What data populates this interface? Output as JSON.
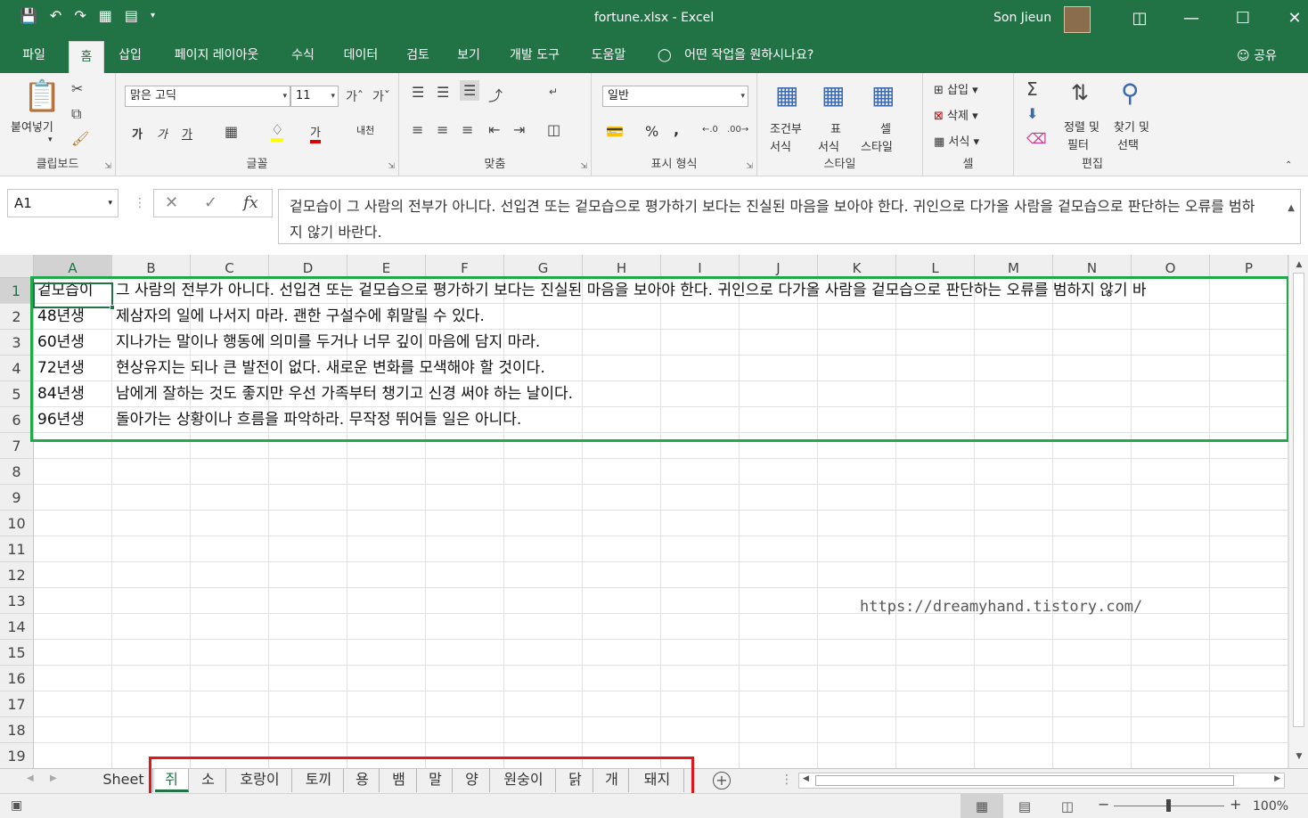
{
  "window": {
    "title": "fortune.xlsx  -  Excel",
    "user": "Son Jieun"
  },
  "menu": {
    "tabs": [
      "파일",
      "홈",
      "삽입",
      "페이지 레이아웃",
      "수식",
      "데이터",
      "검토",
      "보기",
      "개발 도구",
      "도움말"
    ],
    "active_tab": "홈",
    "tell_me": "어떤 작업을 원하시나요?",
    "share": "공유"
  },
  "ribbon": {
    "clipboard": {
      "label": "클립보드",
      "paste": "붙여넣기"
    },
    "font": {
      "label": "글꼴",
      "name": "맑은 고딕",
      "size": "11",
      "bold": "가",
      "italic": "가",
      "underline": "가",
      "color_glyph": "가",
      "phonetic": "내천"
    },
    "alignment": {
      "label": "맞춤"
    },
    "number": {
      "label": "표시 형식",
      "format": "일반",
      "percent": "%",
      "comma": ","
    },
    "styles": {
      "label": "스타일",
      "conditional": "조건부",
      "conditional2": "서식",
      "table": "표",
      "table2": "서식",
      "cell": "셀",
      "cell2": "스타일"
    },
    "cells": {
      "label": "셀",
      "insert": "삽입",
      "delete": "삭제",
      "format": "서식"
    },
    "editing": {
      "label": "편집",
      "sort": "정렬 및",
      "sort2": "필터",
      "find": "찾기 및",
      "find2": "선택"
    }
  },
  "formula_bar": {
    "name_box": "A1",
    "formula": "겉모습이 그 사람의 전부가 아니다. 선입견 또는 겉모습으로 평가하기 보다는 진실된 마음을 보아야 한다. 귀인으로 다가올 사람을 겉모습으로 판단하는 오류를 범하지 않기 바란다."
  },
  "grid": {
    "columns": [
      "A",
      "B",
      "C",
      "D",
      "E",
      "F",
      "G",
      "H",
      "I",
      "J",
      "K",
      "L",
      "M",
      "N",
      "O",
      "P"
    ],
    "rows": [
      "1",
      "2",
      "3",
      "4",
      "5",
      "6",
      "7",
      "8",
      "9",
      "10",
      "11",
      "12",
      "13",
      "14",
      "15",
      "16",
      "17",
      "18",
      "19"
    ],
    "cells": [
      {
        "a": "겉모습이",
        "b": "그 사람의 전부가 아니다. 선입견 또는 겉모습으로 평가하기 보다는 진실된 마음을 보아야 한다. 귀인으로 다가올 사람을 겉모습으로 판단하는 오류를 범하지 않기 바"
      },
      {
        "a": "48년생",
        "b": "제삼자의 일에 나서지 마라. 괜한 구설수에 휘말릴 수 있다."
      },
      {
        "a": "60년생",
        "b": "지나가는 말이나 행동에 의미를 두거나 너무 깊이 마음에 담지 마라."
      },
      {
        "a": "72년생",
        "b": "현상유지는 되나 큰 발전이 없다. 새로운 변화를 모색해야 할 것이다."
      },
      {
        "a": "84년생",
        "b": "남에게 잘하는 것도 좋지만 우선 가족부터 챙기고 신경 써야 하는 날이다."
      },
      {
        "a": "96년생",
        "b": "돌아가는 상황이나 흐름을 파악하라. 무작정 뛰어들 일은 아니다."
      }
    ],
    "watermark": "https://dreamyhand.tistory.com/"
  },
  "sheets": {
    "tabs": [
      "Sheet",
      "쥐",
      "소",
      "호랑이",
      "토끼",
      "용",
      "뱀",
      "말",
      "양",
      "원숭이",
      "닭",
      "개",
      "돼지"
    ],
    "active": "쥐"
  },
  "status": {
    "zoom": "100%"
  },
  "colors": {
    "accent": "#217346",
    "green_highlight": "#21a84b",
    "red_highlight": "#e4161c"
  }
}
